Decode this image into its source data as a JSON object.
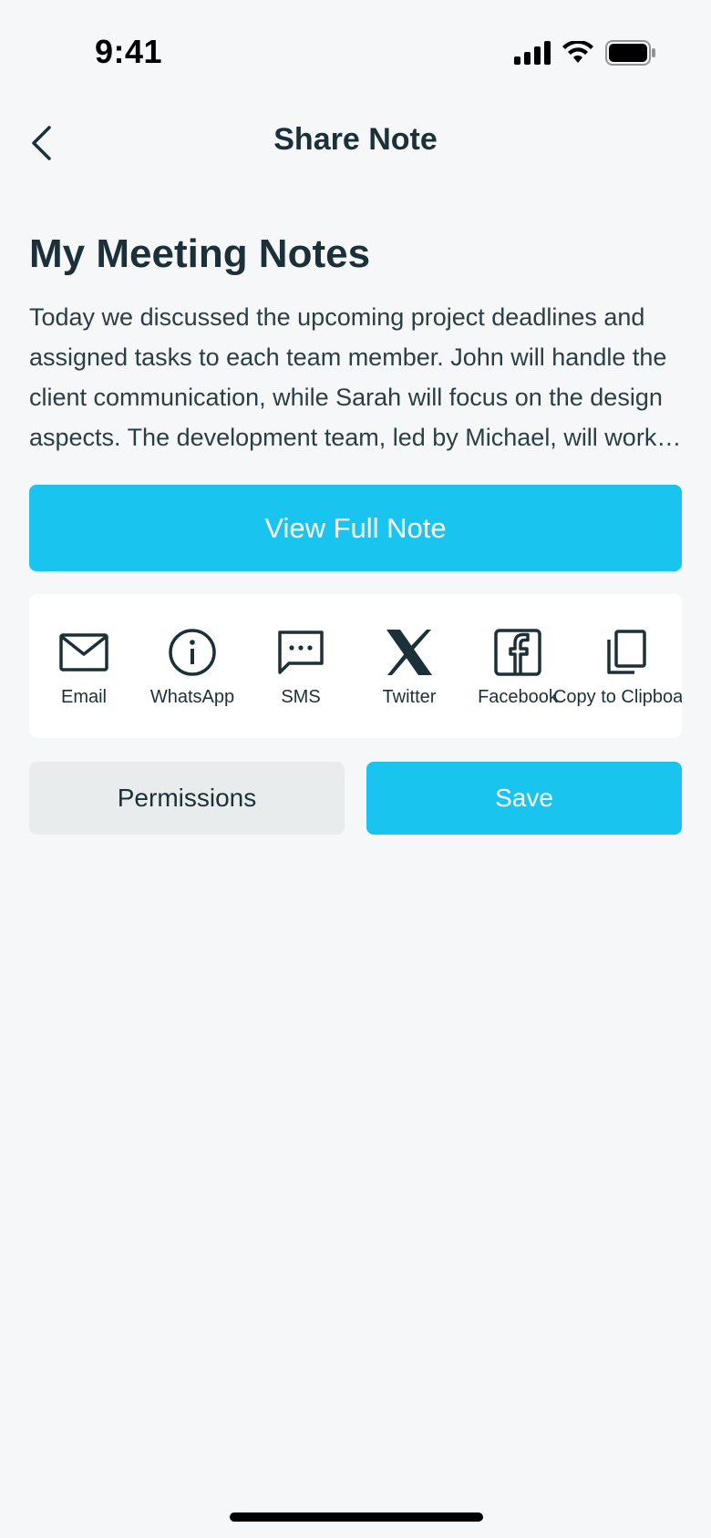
{
  "status_bar": {
    "time": "9:41",
    "icons": [
      "signal-icon",
      "wifi-icon",
      "battery-icon"
    ]
  },
  "header": {
    "title": "Share Note",
    "back_icon": "chevron-left-icon"
  },
  "note": {
    "title": "My Meeting Notes",
    "body": "Today we discussed the upcoming project deadlines and assigned tasks to each team member. John will handle the client communication, while Sarah will focus on the design aspects. The development team, led by Michael, will work on the implementation."
  },
  "actions": {
    "view_full_label": "View Full Note",
    "permissions_label": "Permissions",
    "save_label": "Save"
  },
  "share_options": [
    {
      "label": "Email",
      "icon": "mail-icon"
    },
    {
      "label": "WhatsApp",
      "icon": "info-icon"
    },
    {
      "label": "SMS",
      "icon": "message-icon"
    },
    {
      "label": "Twitter",
      "icon": "x-logo-icon"
    },
    {
      "label": "Facebook",
      "icon": "facebook-icon"
    },
    {
      "label": "Copy to Clipboard",
      "icon": "copy-icon"
    }
  ],
  "colors": {
    "accent": "#19c5ee",
    "text": "#1b3038",
    "background": "#f5f7f9",
    "secondary_button": "#e9ecec"
  }
}
